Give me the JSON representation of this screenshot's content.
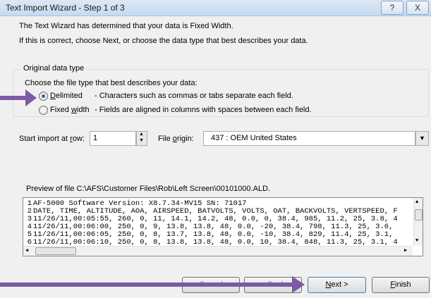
{
  "window": {
    "title": "Text Import Wizard - Step 1 of 3",
    "help_glyph": "?",
    "close_glyph": "X"
  },
  "intro": {
    "line1": "The Text Wizard has determined that your data is Fixed Width.",
    "line2": "If this is correct, choose Next, or choose the data type that best describes your data."
  },
  "original_data_type": {
    "legend": "Original data type",
    "prompt": "Choose the file type that best describes your data:",
    "options": [
      {
        "pre": "",
        "accel": "D",
        "post": "elimited",
        "desc": "- Characters such as commas or tabs separate each field.",
        "selected": true
      },
      {
        "pre": "Fixed ",
        "accel": "w",
        "post": "idth",
        "desc": "- Fields are aligned in columns with spaces between each field.",
        "selected": false
      }
    ]
  },
  "start_row": {
    "label_pre": "Start import at ",
    "label_accel": "r",
    "label_post": "ow:",
    "value": "1"
  },
  "file_origin": {
    "label_pre": "File ",
    "label_accel": "o",
    "label_post": "rigin:",
    "value": "437 : OEM United States"
  },
  "preview": {
    "label": "Preview of file C:\\AFS\\Customer Files\\Rob\\Left Screen\\00101000.ALD.",
    "rows": [
      {
        "num": "1",
        "text": "AF-5000 Software Version: X8.7.34-MV15    SN: 71017"
      },
      {
        "num": "2",
        "text": "DATE, TIME, ALTITUDE, AOA, AIRSPEED, BATVOLTS, VOLTS, OAT, BACKVOLTS, VERTSPEED, F"
      },
      {
        "num": "3",
        "text": "11/26/11,00:05:55, 260, 0, 11, 14.1, 14.2, 48, 0.0, 0, 38.4, 985, 11.2, 25, 3.8, 4"
      },
      {
        "num": "4",
        "text": "11/26/11,00:06:00, 250, 0, 9, 13.8, 13.8, 48, 0.0, -20, 38.4, 798, 11.3, 25, 3.6,"
      },
      {
        "num": "5",
        "text": "11/26/11,00:06:05, 250, 0, 8, 13.7, 13.8, 48, 0.0, -10, 38.4, 829, 11.4, 25, 3.1,"
      },
      {
        "num": "6",
        "text": "11/26/11,00:06:10, 250, 0, 8, 13.8, 13.8, 48, 0.0, 10, 38.4, 848, 11.3, 25, 3.1, 4"
      }
    ]
  },
  "buttons": {
    "cancel": "Cancel",
    "back": "< Back",
    "next_accel": "N",
    "next_post": "ext >",
    "finish_accel": "F",
    "finish_post": "inish"
  },
  "colors": {
    "arrow": "#7b5aa6",
    "radio_dot": "#2c6fb7",
    "titlebar": "#c6daf0"
  }
}
